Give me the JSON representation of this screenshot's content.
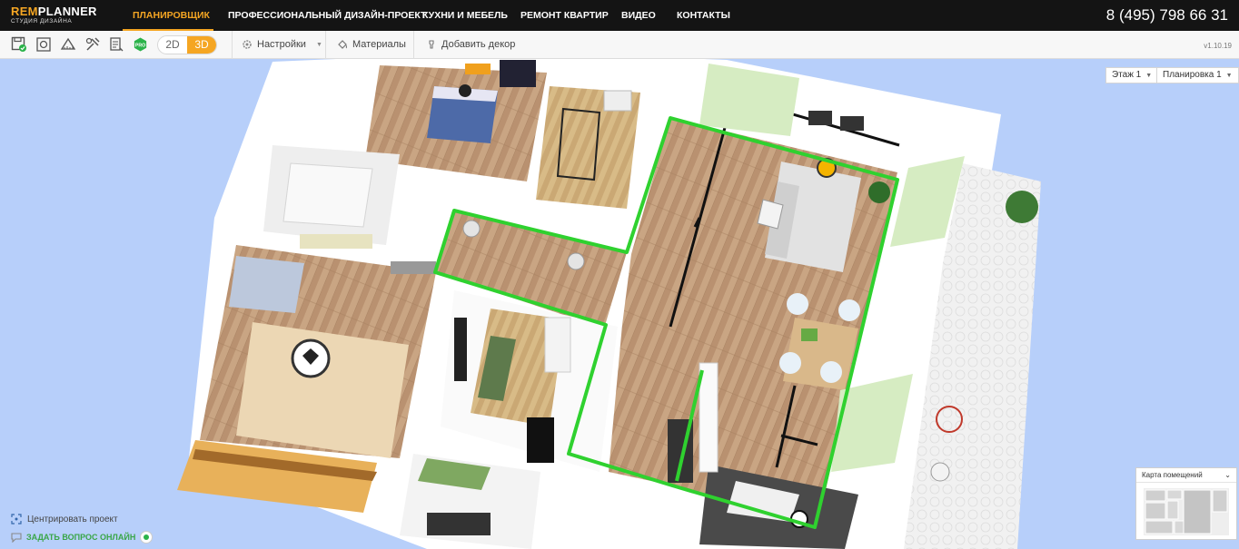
{
  "nav": {
    "logo_brand_rem": "REM",
    "logo_brand_planner": "PLANNER",
    "logo_sub": "СТУДИЯ ДИЗАЙНА",
    "items": [
      {
        "label": "ПЛАНИРОВЩИК",
        "active": true
      },
      {
        "label": "ПРОФЕССИОНАЛЬНЫЙ ДИЗАЙН-ПРОЕКТ",
        "active": false
      },
      {
        "label": "КУХНИ И МЕБЕЛЬ",
        "active": false
      },
      {
        "label": "РЕМОНТ КВАРТИР",
        "active": false
      },
      {
        "label": "ВИДЕО",
        "active": false
      },
      {
        "label": "КОНТАКТЫ",
        "active": false
      }
    ],
    "phone": "8 (495) 798 66 31"
  },
  "toolbar": {
    "icons": [
      "save-icon",
      "screenshot-icon",
      "measure-icon",
      "tools-icon",
      "estimate-icon",
      "pro-badge-icon"
    ],
    "pro_label": "PRO",
    "mode_2d": "2D",
    "mode_3d": "3D",
    "active_mode": "3D",
    "settings_label": "Настройки",
    "materials_label": "Материалы",
    "add_decor_label": "Добавить декор",
    "version": "v1.10.19"
  },
  "canvas": {
    "floor_select": "Этаж 1",
    "layout_select": "Планировка 1",
    "center_project": "Центрировать проект",
    "ask_online": "ЗАДАТЬ ВОПРОС ОНЛАЙН",
    "room_map_title": "Карта помещений"
  },
  "colors": {
    "accent": "#f5a623",
    "nav_bg": "#141414",
    "canvas_bg": "#b7cffa",
    "selection": "#2fd12f",
    "online": "#3aa648"
  }
}
